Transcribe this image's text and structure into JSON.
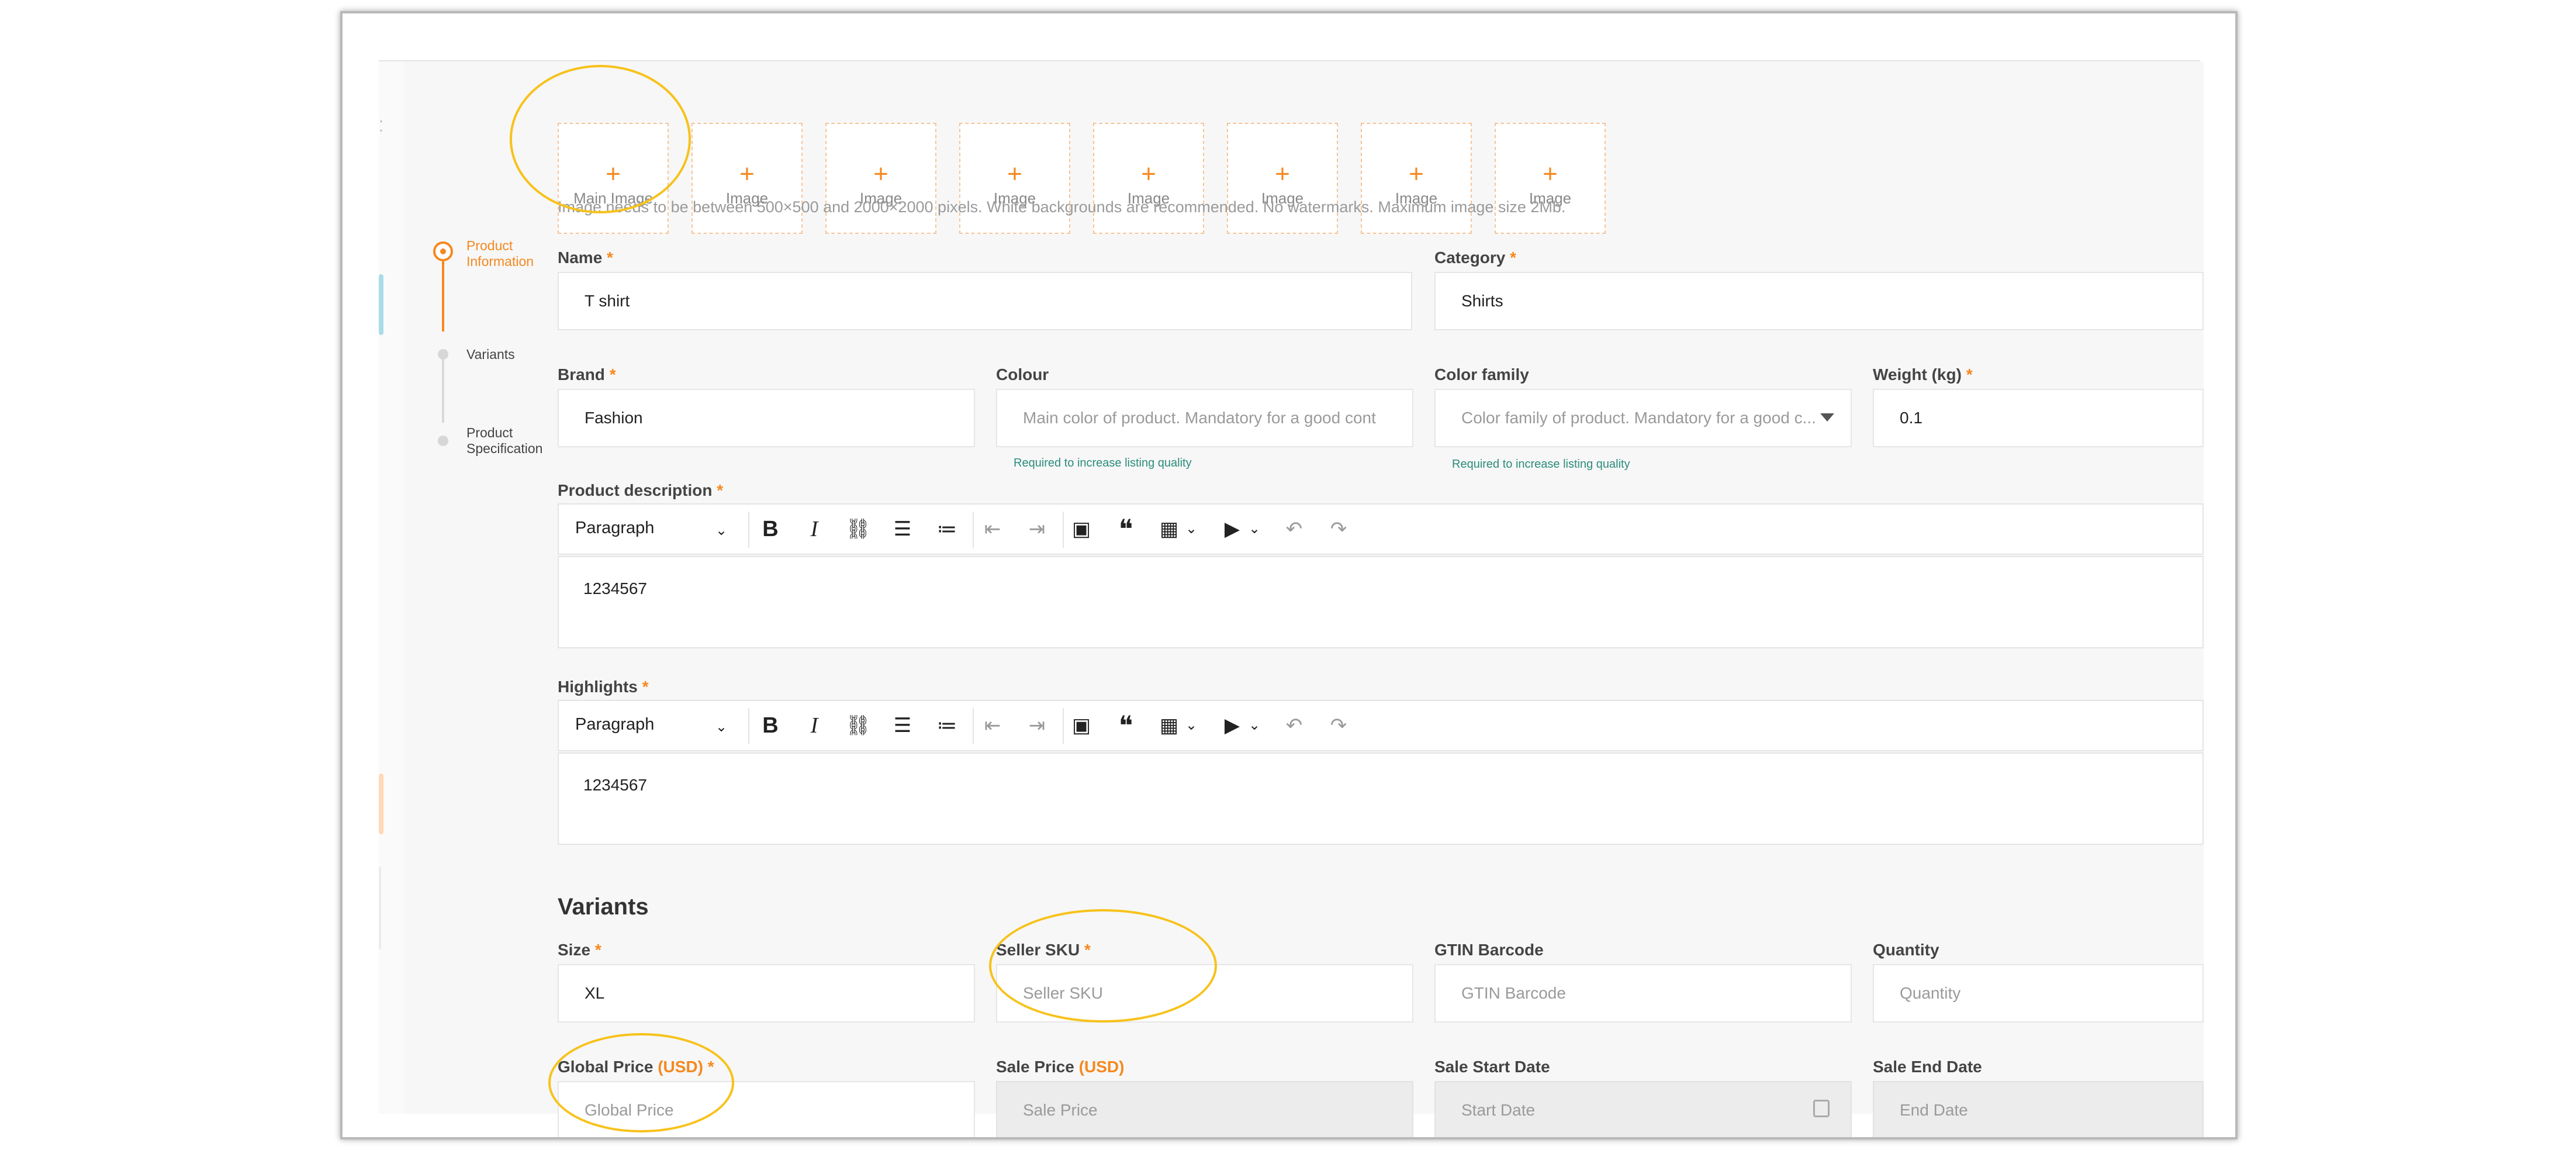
{
  "upload": {
    "tiles": [
      {
        "label": "Main Image",
        "icon": "plus-icon"
      },
      {
        "label": "Image",
        "icon": "plus-icon"
      },
      {
        "label": "Image",
        "icon": "plus-icon"
      },
      {
        "label": "Image",
        "icon": "plus-icon"
      },
      {
        "label": "Image",
        "icon": "plus-icon"
      },
      {
        "label": "Image",
        "icon": "plus-icon"
      },
      {
        "label": "Image",
        "icon": "plus-icon"
      },
      {
        "label": "Image",
        "icon": "plus-icon"
      }
    ],
    "hint": "Image needs to be between 500×500 and 2000×2000 pixels. White backgrounds are recommended. No watermarks. Maximum image size 2Mb."
  },
  "stepper": {
    "steps": [
      {
        "line1": "Product",
        "line2": "Information",
        "state": "active"
      },
      {
        "line1": "Variants",
        "line2": "",
        "state": "inactive"
      },
      {
        "line1": "Product",
        "line2": "Specification",
        "state": "inactive"
      }
    ]
  },
  "form": {
    "name": {
      "label": "Name",
      "required": "*",
      "value": "T shirt"
    },
    "category": {
      "label": "Category",
      "required": "*",
      "value": "Shirts"
    },
    "brand": {
      "label": "Brand",
      "required": "*",
      "value": "Fashion"
    },
    "colour": {
      "label": "Colour",
      "placeholder": "Main color of product. Mandatory for a good cont",
      "note": "Required to increase listing quality"
    },
    "color_family": {
      "label": "Color family",
      "placeholder": "Color family of product. Mandatory for a good c...",
      "note": "Required to increase listing quality"
    },
    "weight": {
      "label": "Weight (kg)",
      "required": "*",
      "value": "0.1"
    },
    "description": {
      "label": "Product description",
      "required": "*",
      "content": "1234567"
    },
    "highlights": {
      "label": "Highlights",
      "required": "*",
      "content": "1234567"
    }
  },
  "editor_toolbar": {
    "paragraph": "Paragraph",
    "icons": [
      "chevron-down-icon",
      "bold-icon",
      "italic-icon",
      "link-icon",
      "bulleted-list-icon",
      "numbered-list-icon",
      "outdent-icon",
      "indent-icon",
      "insert-image-icon",
      "blockquote-icon",
      "insert-table-icon",
      "insert-media-icon",
      "undo-icon",
      "redo-icon"
    ]
  },
  "variants": {
    "title": "Variants",
    "size": {
      "label": "Size",
      "required": "*",
      "value": "XL"
    },
    "seller_sku": {
      "label": "Seller SKU",
      "required": "*",
      "placeholder": "Seller SKU"
    },
    "gtin": {
      "label": "GTIN Barcode",
      "placeholder": "GTIN Barcode"
    },
    "quantity": {
      "label": "Quantity",
      "placeholder": "Quantity"
    },
    "global_price": {
      "label": "Global Price",
      "currency": "(USD)",
      "required": "*",
      "placeholder": "Global Price"
    },
    "sale_price": {
      "label": "Sale Price",
      "currency": "(USD)",
      "placeholder": "Sale Price"
    },
    "sale_start": {
      "label": "Sale Start Date",
      "placeholder": "Start Date"
    },
    "sale_end": {
      "label": "Sale End Date",
      "placeholder": "End Date"
    }
  },
  "colors": {
    "accent": "#f5891f",
    "highlight_ring": "#f7c21b",
    "note": "#2a8c7c"
  }
}
